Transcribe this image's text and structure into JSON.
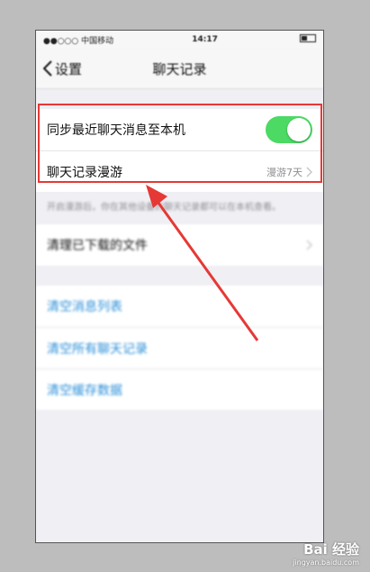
{
  "status_bar": {
    "carrier": "●●○○○ 中国移动",
    "time": "14:17"
  },
  "nav": {
    "back_label": "设置",
    "title": "聊天记录"
  },
  "group1": {
    "sync_label": "同步最近聊天消息至本机",
    "sync_enabled": true,
    "roaming_label": "聊天记录漫游",
    "roaming_value": "漫游7天"
  },
  "note": "开启漫游后，你在其他设备的聊天记录都可以在本机查看。",
  "group2": {
    "clean_files_label": "清理已下载的文件"
  },
  "group3": {
    "items": [
      "清空消息列表",
      "清空所有聊天记录",
      "清空缓存数据"
    ]
  },
  "colors": {
    "toggle_on": "#4cd964",
    "link_blue": "#2a8fd8",
    "highlight_red": "#e53935"
  },
  "watermark": {
    "brand": "Bai 经验",
    "site": "jingyan.baidu.com"
  }
}
